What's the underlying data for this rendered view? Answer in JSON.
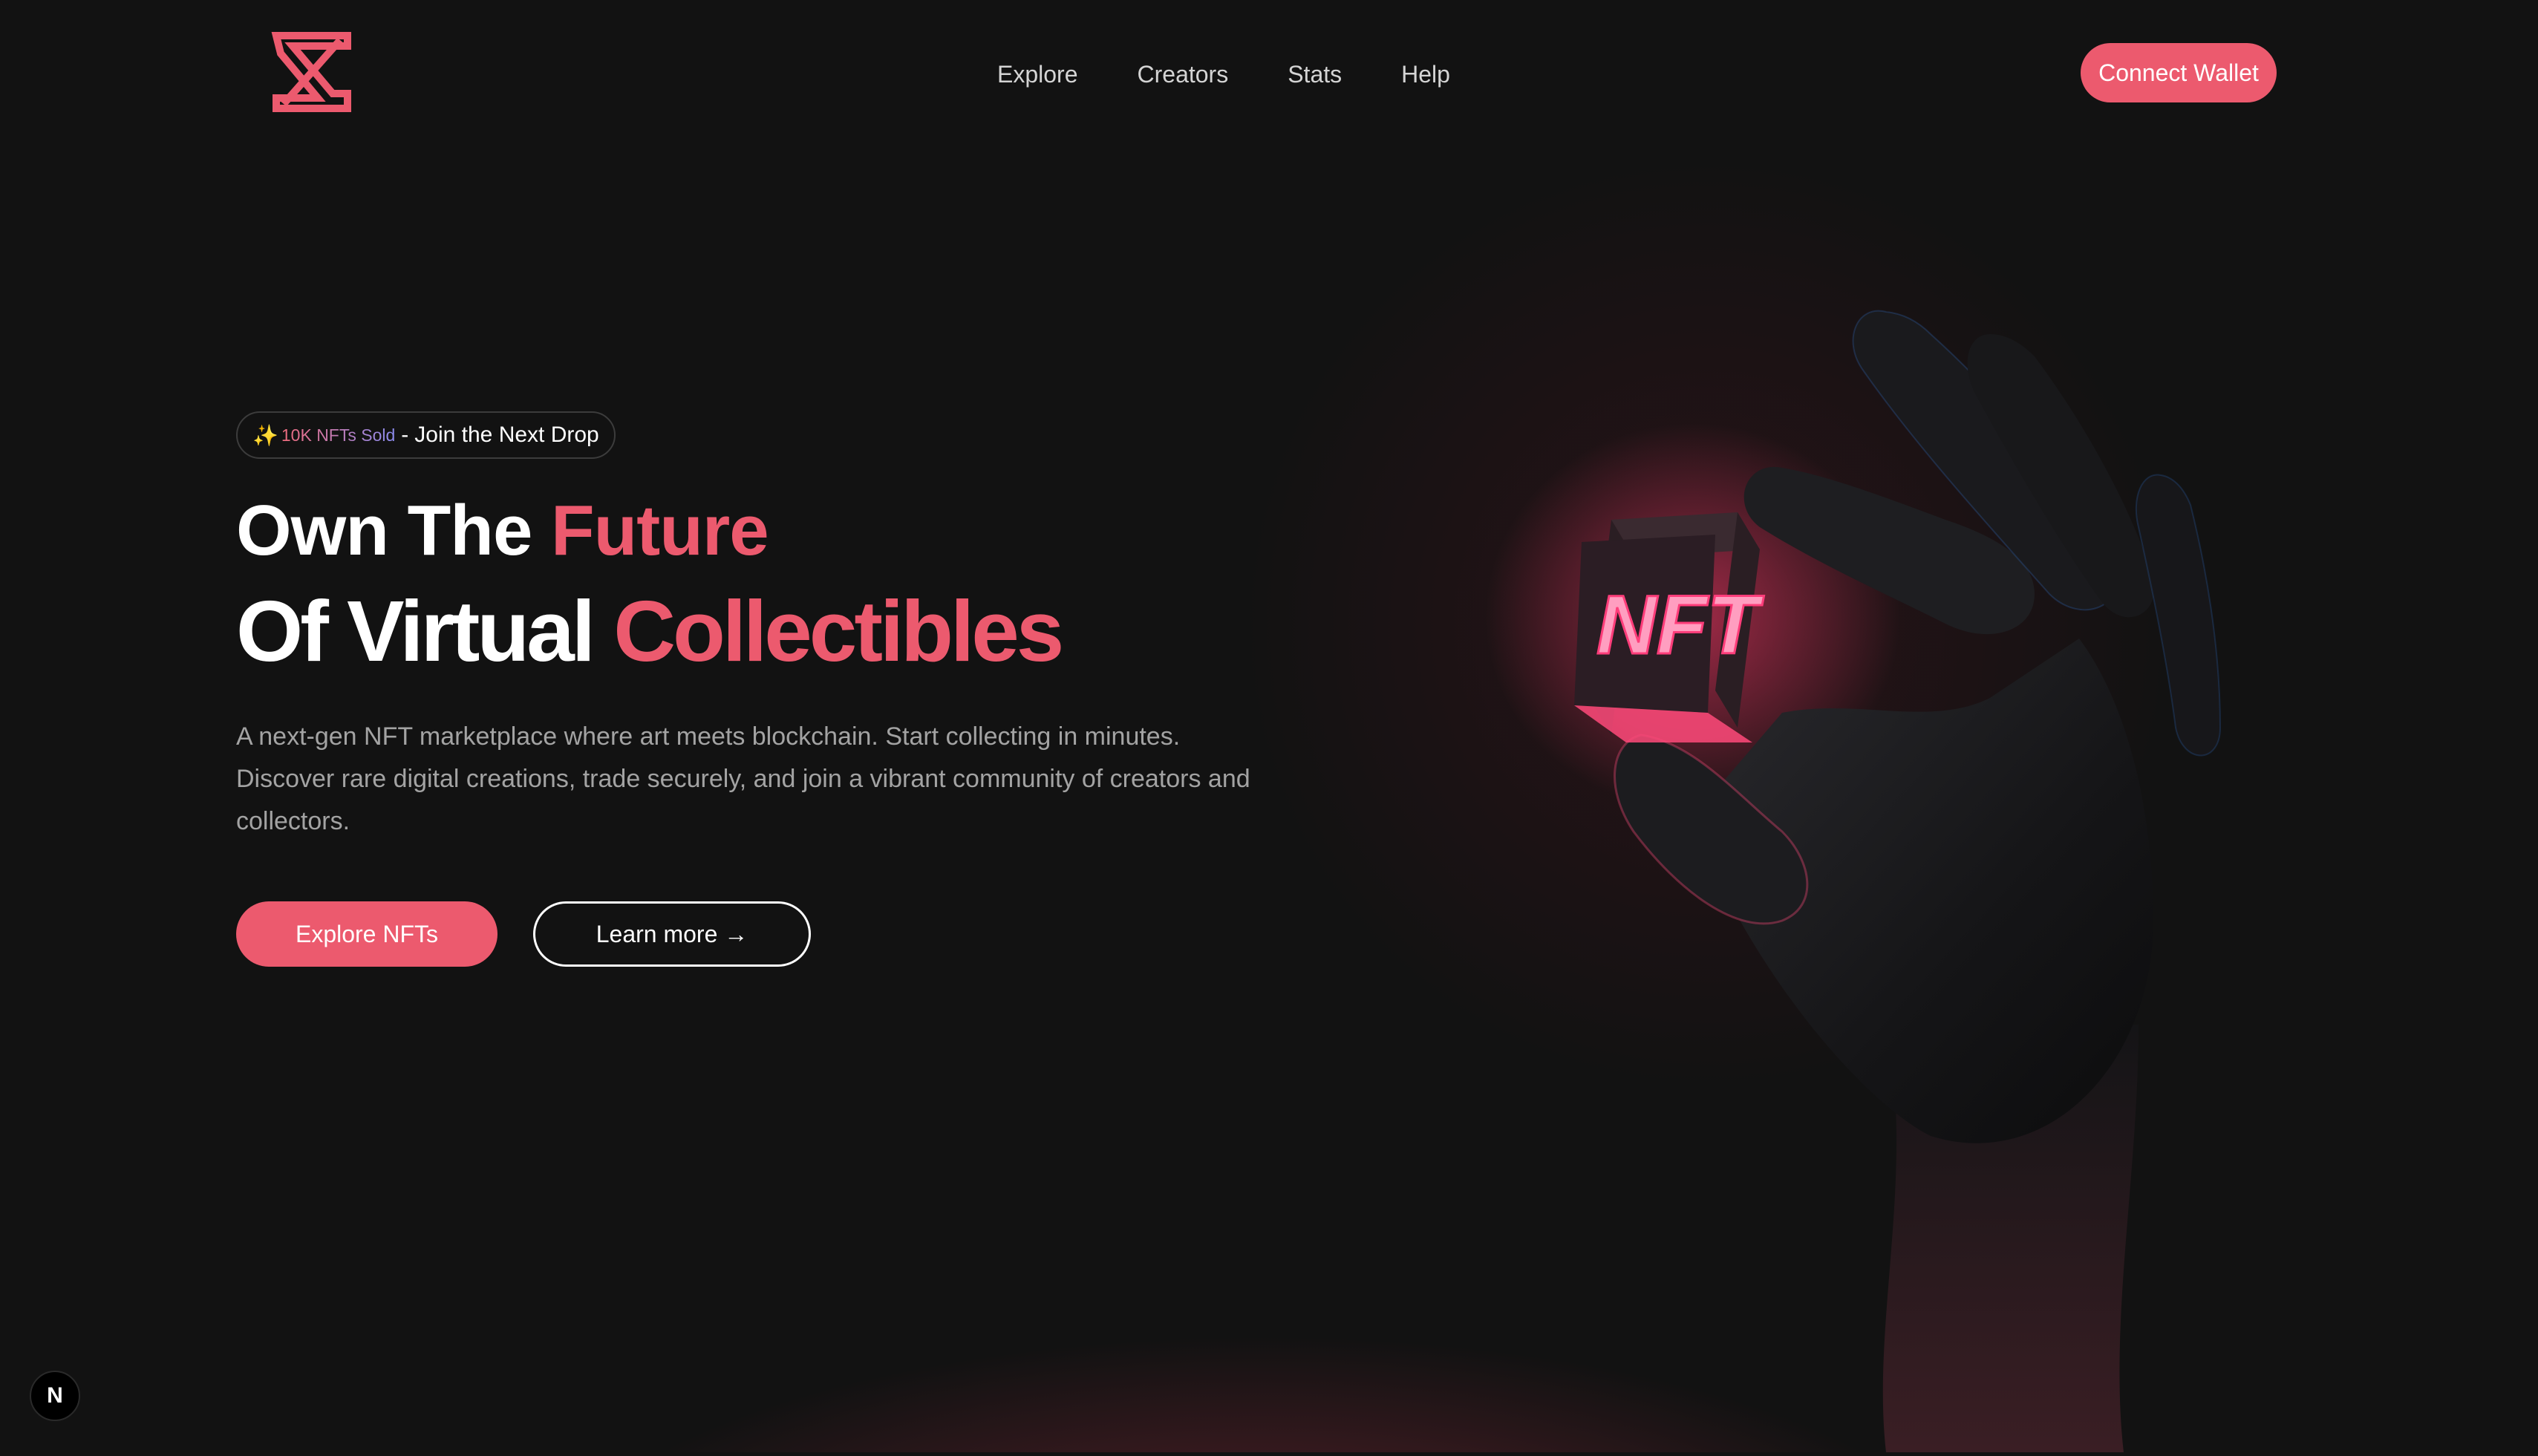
{
  "nav": {
    "logo_icon": "hourglass-logo-icon",
    "links": [
      "Explore",
      "Creators",
      "Stats",
      "Help"
    ],
    "connect_label": "Connect Wallet"
  },
  "badge": {
    "icon": "sparkles-icon",
    "sold_text": "10K NFTs Sold",
    "separator": "-",
    "join_text": "Join the Next Drop"
  },
  "hero": {
    "line1_plain": "Own The ",
    "line1_accent": "Future",
    "line2_plain": "Of Virtual ",
    "line2_accent": "Collectibles",
    "description": "A next-gen NFT marketplace where art meets blockchain. Start collecting in minutes. Discover rare digital creations, trade securely, and join a vibrant community of creators and collectors.",
    "primary_label": "Explore NFTs",
    "secondary_label": "Learn more →",
    "image_cube_text": "NFT"
  },
  "dev_indicator": {
    "letter": "N"
  },
  "colors": {
    "background": "#121212",
    "accent": "#ec5a6e",
    "muted_text": "#a3a3a3"
  }
}
